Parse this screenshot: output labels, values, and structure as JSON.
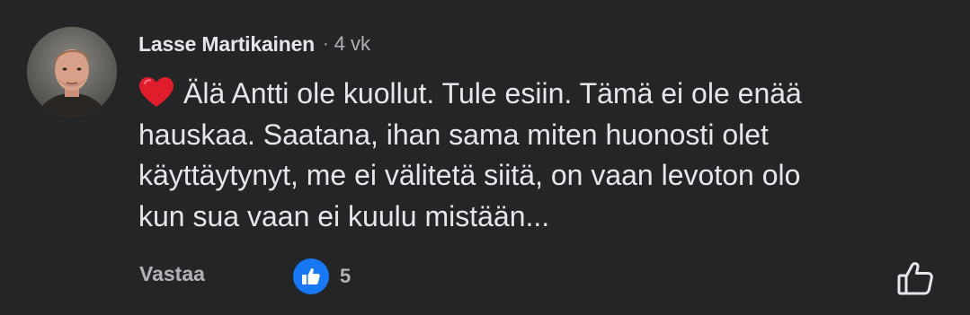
{
  "comment": {
    "author": "Lasse Martikainen",
    "separator": "·",
    "timestamp": "4 vk",
    "emoji_icon": "red-heart-icon",
    "lines": [
      "Älä Antti ole kuollut. Tule esiin. Tämä ei ole enää",
      "hauskaa. Saatana, ihan sama miten huonosti olet",
      "käyttäytynyt, me ei välitetä siitä, on vaan levoton olo",
      "kun sua vaan ei kuulu mistään..."
    ],
    "reply_label": "Vastaa",
    "reaction": {
      "icon": "thumbs-up-icon",
      "count": "5",
      "color": "#1877f2"
    },
    "like_icon": "thumbs-up-outline-icon"
  },
  "theme": {
    "background": "#242526",
    "text_primary": "#e4e6eb",
    "text_secondary": "#b0b3b8",
    "heart_color": "#e01e2b"
  }
}
